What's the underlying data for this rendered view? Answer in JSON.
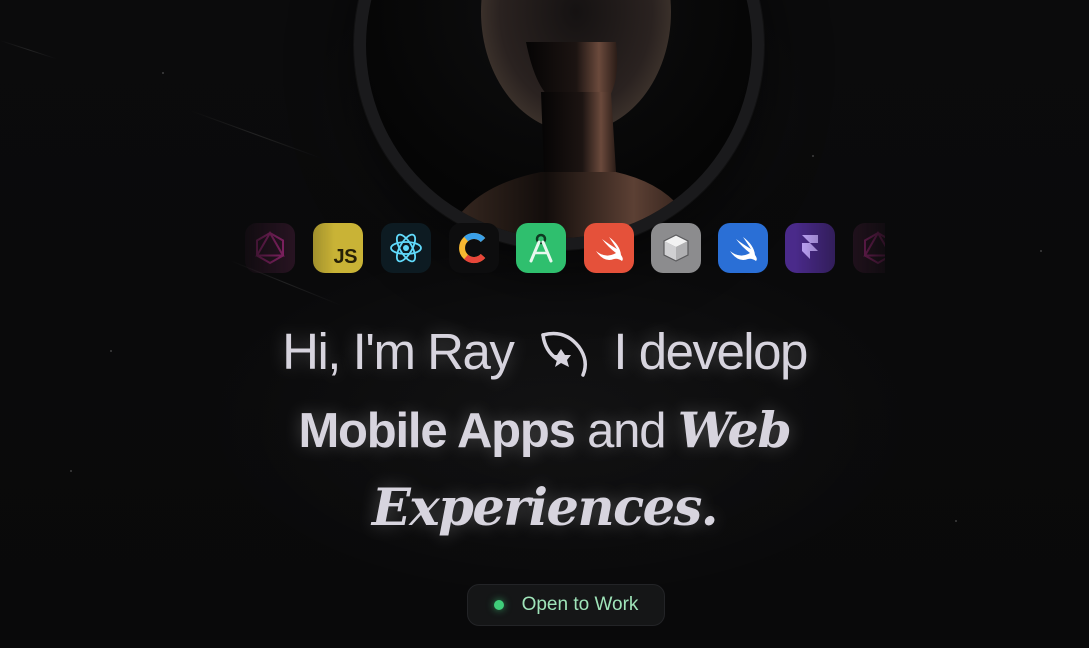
{
  "hero": {
    "greeting": "Hi, I'm Ray",
    "develop_text": "I develop",
    "mobile_apps": "Mobile Apps",
    "and_text": " and ",
    "web_text": "Web",
    "experiences_text": "Experiences."
  },
  "status_badge": {
    "label": "Open to Work",
    "color": "#3fcf7a"
  },
  "tech_icons": [
    {
      "name": "graphql-icon",
      "color": "#e535ab"
    },
    {
      "name": "javascript-icon",
      "label": "JS",
      "color": "#f0db4f"
    },
    {
      "name": "react-icon",
      "color": "#61dafb"
    },
    {
      "name": "c-language-icon",
      "color": "#f7b731"
    },
    {
      "name": "android-studio-icon",
      "color": "#3ddc84"
    },
    {
      "name": "swift-icon",
      "color": "#f05138"
    },
    {
      "name": "3d-box-icon",
      "color": "#8c8c8c"
    },
    {
      "name": "swiftui-icon",
      "color": "#2a6fd6"
    },
    {
      "name": "framer-icon",
      "color": "#7b3ff2"
    },
    {
      "name": "graphql-icon",
      "color": "#e535ab"
    }
  ],
  "colors": {
    "background": "#0a0a0b",
    "headline": "#d7d4de",
    "status_text": "#9fe4b9"
  }
}
